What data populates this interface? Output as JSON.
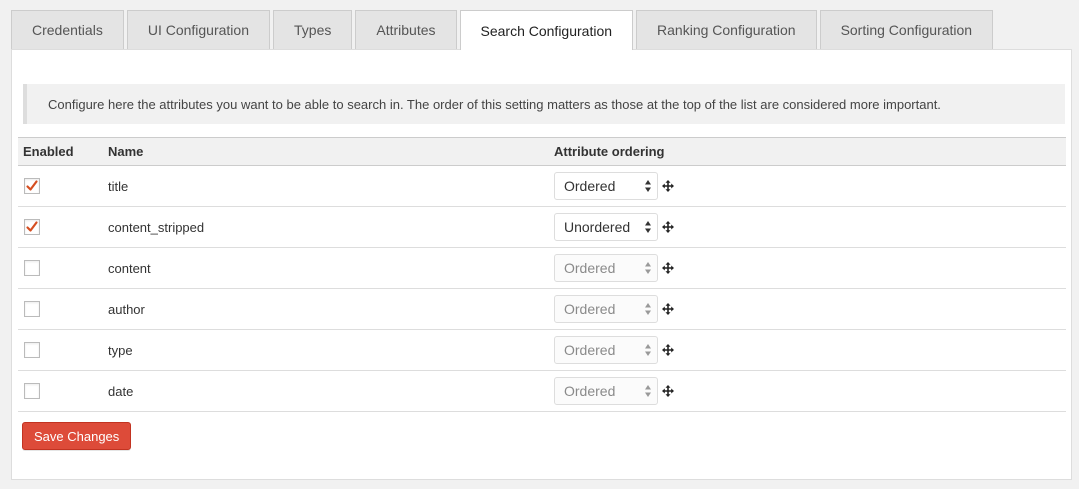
{
  "tabs": [
    {
      "label": "Credentials",
      "active": false
    },
    {
      "label": "UI Configuration",
      "active": false
    },
    {
      "label": "Types",
      "active": false
    },
    {
      "label": "Attributes",
      "active": false
    },
    {
      "label": "Search Configuration",
      "active": true
    },
    {
      "label": "Ranking Configuration",
      "active": false
    },
    {
      "label": "Sorting Configuration",
      "active": false
    }
  ],
  "notice": "Configure here the attributes you want to be able to search in. The order of this setting matters as those at the top of the list are considered more important.",
  "table": {
    "headers": {
      "enabled": "Enabled",
      "name": "Name",
      "ordering": "Attribute ordering"
    },
    "rows": [
      {
        "enabled": true,
        "name": "title",
        "ordering": "Ordered"
      },
      {
        "enabled": true,
        "name": "content_stripped",
        "ordering": "Unordered"
      },
      {
        "enabled": false,
        "name": "content",
        "ordering": "Ordered"
      },
      {
        "enabled": false,
        "name": "author",
        "ordering": "Ordered"
      },
      {
        "enabled": false,
        "name": "type",
        "ordering": "Ordered"
      },
      {
        "enabled": false,
        "name": "date",
        "ordering": "Ordered"
      }
    ]
  },
  "save_button": "Save Changes",
  "colors": {
    "accent": "#dd4b39",
    "check": "#d54e21"
  },
  "icons": {
    "checkbox_check": "check-icon",
    "select_arrows": "select-arrows-icon",
    "drag": "move-icon"
  }
}
